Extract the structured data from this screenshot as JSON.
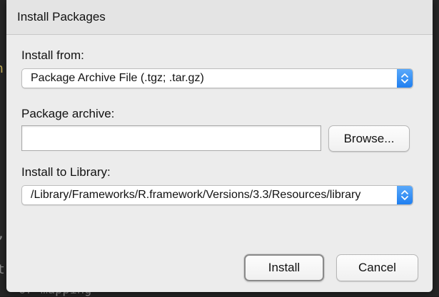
{
  "background_code": {
    "line1": "h",
    "line2": ",",
    "line3": "t",
    "line4": "or  mapping"
  },
  "dialog": {
    "title": "Install Packages",
    "install_from": {
      "label": "Install from:",
      "selected": "Package Archive File (.tgz; .tar.gz)"
    },
    "package_archive": {
      "label": "Package archive:",
      "value": "",
      "placeholder": ""
    },
    "browse_label": "Browse...",
    "install_to_library": {
      "label": "Install to Library:",
      "selected": "/Library/Frameworks/R.framework/Versions/3.3/Resources/library"
    },
    "install_label": "Install",
    "cancel_label": "Cancel"
  },
  "colors": {
    "dialog_bg": "#ececec",
    "stepper_accent": "#1f7ff0"
  },
  "icons": {
    "select_stepper": "up-down-chevron-icon"
  }
}
